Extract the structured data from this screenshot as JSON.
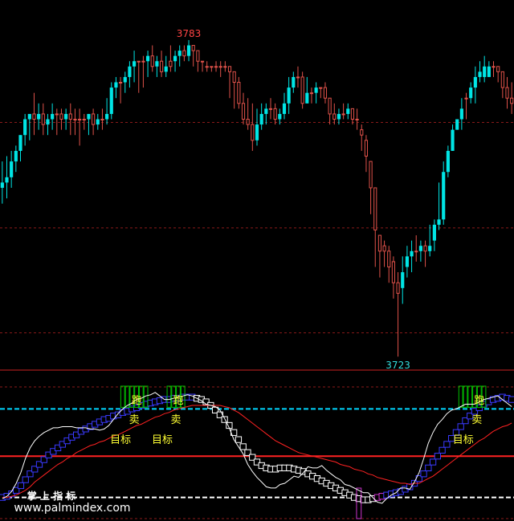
{
  "chart_data": {
    "type": "candlestick",
    "colors": {
      "up": "#e0524a",
      "down": "#00e5e5",
      "background": "#000000",
      "grid_dash": "#8b1a1a",
      "panel_divider": "#cc2222",
      "ema_line": "#ff2222",
      "osc_line": "#ffffff",
      "blue_box": "#3a3aff",
      "white_box": "#ffffff",
      "green_box": "#00c000",
      "magenta_box": "#cc33cc",
      "high_label": "#ff4444",
      "low_label": "#33dddd",
      "signal_text": "#ffff33",
      "cyan_level": "#00d7ff",
      "red_level": "#ff2222"
    },
    "price": {
      "ylim": [
        3720.6,
        3790.6
      ],
      "high_label": "3783",
      "low_label": "3723",
      "gridlines": [
        3767.4,
        3747.4,
        3727.5
      ],
      "candles": [
        [
          3760,
          3756,
          3752,
          3755
        ],
        [
          3761,
          3757,
          3753,
          3756
        ],
        [
          3762,
          3760,
          3755,
          3757
        ],
        [
          3763,
          3762,
          3758,
          3760
        ],
        [
          3765,
          3765,
          3760,
          3762
        ],
        [
          3769,
          3768,
          3763,
          3765
        ],
        [
          3769,
          3769,
          3764,
          3768
        ],
        [
          3773,
          3768,
          3765,
          3769
        ],
        [
          3771,
          3769,
          3766,
          3768
        ],
        [
          3771,
          3767,
          3765,
          3769
        ],
        [
          3769,
          3768,
          3765,
          3767
        ],
        [
          3771,
          3769,
          3766,
          3768
        ],
        [
          3770,
          3769,
          3765,
          3769
        ],
        [
          3770,
          3768,
          3766,
          3769
        ],
        [
          3770,
          3769,
          3766,
          3768
        ],
        [
          3771,
          3768,
          3765,
          3769
        ],
        [
          3770,
          3768,
          3765,
          3768
        ],
        [
          3770,
          3768,
          3763,
          3768
        ],
        [
          3769,
          3768,
          3766,
          3768
        ],
        [
          3769,
          3769,
          3765,
          3768
        ],
        [
          3770,
          3767,
          3765,
          3769
        ],
        [
          3769,
          3768,
          3766,
          3767
        ],
        [
          3770,
          3768,
          3766,
          3768
        ],
        [
          3772,
          3769,
          3767,
          3768
        ],
        [
          3775,
          3774,
          3768,
          3769
        ],
        [
          3776,
          3775,
          3772,
          3774
        ],
        [
          3776,
          3775,
          3771,
          3775
        ],
        [
          3777,
          3776,
          3773,
          3775
        ],
        [
          3779,
          3778,
          3774,
          3776
        ],
        [
          3781,
          3779,
          3775,
          3778
        ],
        [
          3779,
          3779,
          3773,
          3779
        ],
        [
          3780,
          3779,
          3774,
          3779
        ],
        [
          3781,
          3780,
          3776,
          3779
        ],
        [
          3782,
          3778,
          3777,
          3780
        ],
        [
          3780,
          3779,
          3776,
          3778
        ],
        [
          3781,
          3777,
          3776,
          3779
        ],
        [
          3780,
          3778,
          3776,
          3777
        ],
        [
          3782,
          3778,
          3777,
          3779
        ],
        [
          3781,
          3780,
          3777,
          3779
        ],
        [
          3782,
          3781,
          3778,
          3780
        ],
        [
          3782,
          3780,
          3779,
          3781
        ],
        [
          3783,
          3782,
          3779,
          3780
        ],
        [
          3781,
          3781,
          3778,
          3782
        ],
        [
          3780,
          3779,
          3777,
          3781
        ],
        [
          3779,
          3779,
          3777,
          3779
        ],
        [
          3779,
          3778,
          3777,
          3778
        ],
        [
          3778,
          3778,
          3777,
          3778
        ],
        [
          3779,
          3778,
          3777,
          3778
        ],
        [
          3779,
          3778,
          3776,
          3778
        ],
        [
          3779,
          3778,
          3777,
          3778
        ],
        [
          3778,
          3777,
          3772,
          3778
        ],
        [
          3777,
          3775,
          3770,
          3777
        ],
        [
          3776,
          3771,
          3770,
          3775
        ],
        [
          3773,
          3768,
          3767,
          3771
        ],
        [
          3772,
          3767,
          3766,
          3768
        ],
        [
          3771,
          3764,
          3762,
          3767
        ],
        [
          3770,
          3767,
          3763,
          3764
        ],
        [
          3771,
          3769,
          3766,
          3767
        ],
        [
          3771,
          3770,
          3767,
          3769
        ],
        [
          3772,
          3770,
          3768,
          3770
        ],
        [
          3771,
          3768,
          3767,
          3770
        ],
        [
          3770,
          3769,
          3767,
          3768
        ],
        [
          3773,
          3771,
          3768,
          3769
        ],
        [
          3776,
          3774,
          3769,
          3771
        ],
        [
          3777,
          3776,
          3773,
          3774
        ],
        [
          3778,
          3776,
          3774,
          3776
        ],
        [
          3777,
          3771,
          3770,
          3776
        ],
        [
          3776,
          3773,
          3771,
          3771
        ],
        [
          3774,
          3773,
          3771,
          3773
        ],
        [
          3775,
          3774,
          3771,
          3773
        ],
        [
          3774,
          3774,
          3772,
          3774
        ],
        [
          3775,
          3772,
          3771,
          3774
        ],
        [
          3772,
          3769,
          3767,
          3772
        ],
        [
          3771,
          3768,
          3767,
          3769
        ],
        [
          3770,
          3769,
          3767,
          3768
        ],
        [
          3771,
          3769,
          3768,
          3769
        ],
        [
          3771,
          3770,
          3768,
          3769
        ],
        [
          3770,
          3768,
          3767,
          3770
        ],
        [
          3770,
          3768,
          3766,
          3768
        ],
        [
          3767,
          3765,
          3762,
          3766
        ],
        [
          3765,
          3761,
          3758,
          3764
        ],
        [
          3760,
          3755,
          3750,
          3760
        ],
        [
          3755,
          3747,
          3740,
          3755
        ],
        [
          3746,
          3743,
          3738,
          3746
        ],
        [
          3745,
          3743,
          3740,
          3744
        ],
        [
          3744,
          3740,
          3737,
          3743
        ],
        [
          3742,
          3737,
          3734,
          3741
        ],
        [
          3739,
          3735,
          3723,
          3737
        ],
        [
          3742,
          3739,
          3733,
          3736
        ],
        [
          3744,
          3742,
          3738,
          3740
        ],
        [
          3745,
          3743,
          3739,
          3742
        ],
        [
          3746,
          3743,
          3741,
          3743
        ],
        [
          3745,
          3744,
          3741,
          3743
        ],
        [
          3745,
          3743,
          3740,
          3744
        ],
        [
          3748,
          3744,
          3742,
          3743
        ],
        [
          3749,
          3748,
          3743,
          3745
        ],
        [
          3756,
          3749,
          3747,
          3748
        ],
        [
          3760,
          3758,
          3748,
          3749
        ],
        [
          3763,
          3762,
          3757,
          3758
        ],
        [
          3767,
          3766,
          3762,
          3762
        ],
        [
          3768,
          3768,
          3766,
          3766
        ],
        [
          3772,
          3770,
          3766,
          3768
        ],
        [
          3773,
          3772,
          3768,
          3772
        ],
        [
          3775,
          3774,
          3771,
          3772
        ],
        [
          3778,
          3776,
          3771,
          3774
        ],
        [
          3779,
          3777,
          3775,
          3776
        ],
        [
          3780,
          3778,
          3775,
          3776
        ],
        [
          3779,
          3778,
          3776,
          3776
        ],
        [
          3779,
          3778,
          3776,
          3778
        ],
        [
          3778,
          3777,
          3775,
          3778
        ],
        [
          3777,
          3774,
          3772,
          3777
        ],
        [
          3776,
          3772,
          3770,
          3774
        ],
        [
          3775,
          3771,
          3769,
          3772
        ]
      ]
    },
    "oscillator": {
      "ylim": [
        0,
        100
      ],
      "cyan_level": 80,
      "red_level": 40,
      "white_dashed_level": 5,
      "osc_values": [
        4,
        6,
        10,
        17,
        26,
        38,
        47,
        53,
        57,
        60,
        62,
        64,
        64,
        65,
        65,
        65,
        64,
        64,
        64,
        63,
        63,
        62,
        63,
        66,
        71,
        76,
        80,
        83,
        85,
        88,
        89,
        91,
        92,
        94,
        91,
        88,
        88,
        89,
        90,
        91,
        92,
        91,
        89,
        87,
        84,
        83,
        82,
        79,
        72,
        64,
        54,
        48,
        42,
        33,
        27,
        22,
        18,
        14,
        13,
        13,
        16,
        17,
        20,
        23,
        22,
        26,
        31,
        30,
        30,
        32,
        28,
        25,
        22,
        20,
        16,
        15,
        13,
        11,
        9,
        9,
        5,
        1,
        0,
        4,
        7,
        9,
        13,
        13,
        12,
        18,
        26,
        38,
        51,
        60,
        67,
        71,
        76,
        79,
        80,
        82,
        84,
        84,
        84,
        86,
        88,
        89,
        90,
        91,
        88,
        85,
        82
      ],
      "ema_values": [
        5,
        5,
        6,
        7,
        9,
        11,
        14,
        18,
        21,
        24,
        27,
        30,
        33,
        35,
        38,
        40,
        43,
        45,
        47,
        49,
        50,
        52,
        53,
        55,
        57,
        58,
        60,
        62,
        64,
        66,
        67,
        69,
        71,
        73,
        74,
        76,
        77,
        79,
        80,
        81,
        82,
        83,
        83,
        83,
        83,
        83,
        83,
        83,
        82,
        81,
        79,
        77,
        74,
        71,
        68,
        65,
        62,
        59,
        56,
        53,
        51,
        49,
        47,
        45,
        43,
        42,
        41,
        40,
        39,
        38,
        37,
        36,
        35,
        33,
        32,
        31,
        29,
        28,
        27,
        25,
        24,
        22,
        21,
        20,
        19,
        18,
        17,
        17,
        16,
        17,
        17,
        19,
        21,
        23,
        26,
        29,
        32,
        35,
        38,
        41,
        44,
        47,
        50,
        53,
        55,
        58,
        61,
        63,
        65,
        66,
        68
      ],
      "box_values": [
        5,
        6,
        8,
        11,
        15,
        20,
        25,
        29,
        33,
        37,
        41,
        44,
        47,
        50,
        53,
        56,
        58,
        61,
        63,
        65,
        67,
        69,
        71,
        72,
        74,
        75,
        77,
        78,
        80,
        81,
        83,
        84,
        85,
        86,
        87,
        88,
        88,
        89,
        89,
        90,
        90,
        90,
        89,
        88,
        86,
        83,
        79,
        75,
        71,
        66,
        60,
        54,
        48,
        43,
        39,
        35,
        32,
        30,
        29,
        29,
        30,
        30,
        30,
        29,
        28,
        27,
        25,
        23,
        21,
        19,
        17,
        15,
        13,
        11,
        9,
        7,
        5,
        4,
        3,
        3,
        4,
        5,
        6,
        7,
        8,
        9,
        10,
        12,
        14,
        17,
        21,
        25,
        30,
        35,
        40,
        45,
        50,
        55,
        60,
        65,
        70,
        74,
        78,
        81,
        84,
        86,
        88,
        89,
        90,
        89,
        88
      ],
      "box_colors": "BBBBBBBBBBBBBBBBBBBBBBBBBBBBBBBBBBBBBBBBBBWWWWWWWWWWWWWWWWWWWWWWWWWWWWWWWWWWWWWWWMMBBBBBBBBBBBBBBBBBBBBBBBBBBBBBBWW",
      "green_box_ranges": [
        [
          26,
          31
        ],
        [
          36,
          39
        ],
        [
          99,
          104
        ]
      ],
      "magenta_bar_index": 77,
      "signals": [
        {
          "index": 29,
          "run": "跑",
          "sell": "卖",
          "target": "目标"
        },
        {
          "index": 38,
          "run": "跑",
          "sell": "卖",
          "target": "目标"
        },
        {
          "index": 103,
          "run": "跑",
          "sell": "卖",
          "target": "目标"
        }
      ]
    },
    "watermark": {
      "line1": "掌 上 指 标",
      "line2": "www.palmindex.com"
    }
  }
}
